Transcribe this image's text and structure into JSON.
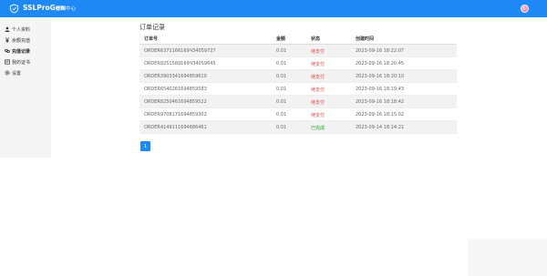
{
  "header": {
    "brand": "SSLProGen",
    "nav_link": "控制中心",
    "accent": "#1e88f5"
  },
  "sidebar": {
    "items": [
      {
        "label": "个人资料",
        "icon": "user-icon"
      },
      {
        "label": "余额充值",
        "icon": "yen-icon"
      },
      {
        "label": "充值记录",
        "icon": "link-icon",
        "active": true
      },
      {
        "label": "我的证书",
        "icon": "certificate-icon"
      },
      {
        "label": "设置",
        "icon": "gear-icon"
      }
    ]
  },
  "main": {
    "title": "订单记录",
    "columns": [
      "订单号",
      "金额",
      "状态",
      "创建时间"
    ],
    "rows": [
      {
        "order": "ORDER6371166169ЧЗ4059727",
        "amount": "0.01",
        "status": "待支付",
        "status_type": "pending",
        "time": "2023-09-16 18:22:07"
      },
      {
        "order": "ORDER9251580169ЧЗ4059645",
        "amount": "0.01",
        "status": "待支付",
        "status_type": "pending",
        "time": "2023-09-16 18:20:45"
      },
      {
        "order": "ORDER3903341694859610",
        "amount": "0.01",
        "status": "待支付",
        "status_type": "pending",
        "time": "2023-09-16 18:20:10"
      },
      {
        "order": "ORDER6540261694859583",
        "amount": "0.01",
        "status": "待支付",
        "status_type": "pending",
        "time": "2023-09-16 18:19:43"
      },
      {
        "order": "ORDER8250461694859522",
        "amount": "0.01",
        "status": "待支付",
        "status_type": "pending",
        "time": "2023-09-16 18:18:42"
      },
      {
        "order": "ORDER9708171694859302",
        "amount": "0.01",
        "status": "待支付",
        "status_type": "pending",
        "time": "2023-09-16 18:15:02"
      },
      {
        "order": "ORDER4149111694686461",
        "amount": "0.01",
        "status": "已完成",
        "status_type": "done",
        "time": "2023-09-14 18:14:21"
      }
    ],
    "pagination": {
      "current": "1"
    }
  }
}
